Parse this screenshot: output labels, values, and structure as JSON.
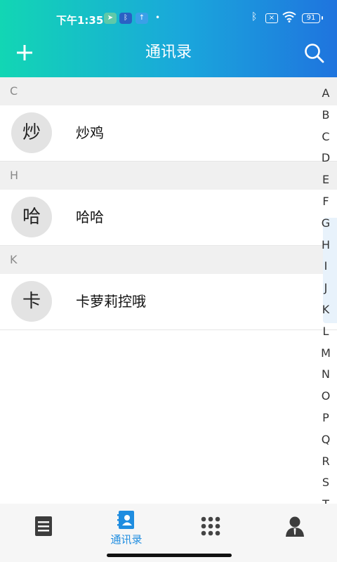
{
  "status_bar": {
    "time": "下午1:35",
    "battery": "91"
  },
  "header": {
    "title": "通讯录",
    "add_icon": "plus-icon",
    "search_icon": "search-icon"
  },
  "contacts": [
    {
      "section": "C",
      "avatar": "炒",
      "name": "炒鸡"
    },
    {
      "section": "H",
      "avatar": "哈",
      "name": "哈哈"
    },
    {
      "section": "K",
      "avatar": "卡",
      "name": "卡萝莉控哦"
    }
  ],
  "index_letters": [
    "A",
    "B",
    "C",
    "D",
    "E",
    "F",
    "G",
    "H",
    "I",
    "J",
    "K",
    "L",
    "M",
    "N",
    "O",
    "P",
    "Q",
    "R",
    "S",
    "T"
  ],
  "tabs": [
    {
      "icon": "notes-icon",
      "label": ""
    },
    {
      "icon": "contacts-book-icon",
      "label": "通讯录",
      "active": true
    },
    {
      "icon": "dialpad-icon",
      "label": ""
    },
    {
      "icon": "profile-icon",
      "label": ""
    }
  ],
  "colors": {
    "header_start": "#12d6b4",
    "header_end": "#1f74de",
    "accent": "#1f8de0"
  }
}
